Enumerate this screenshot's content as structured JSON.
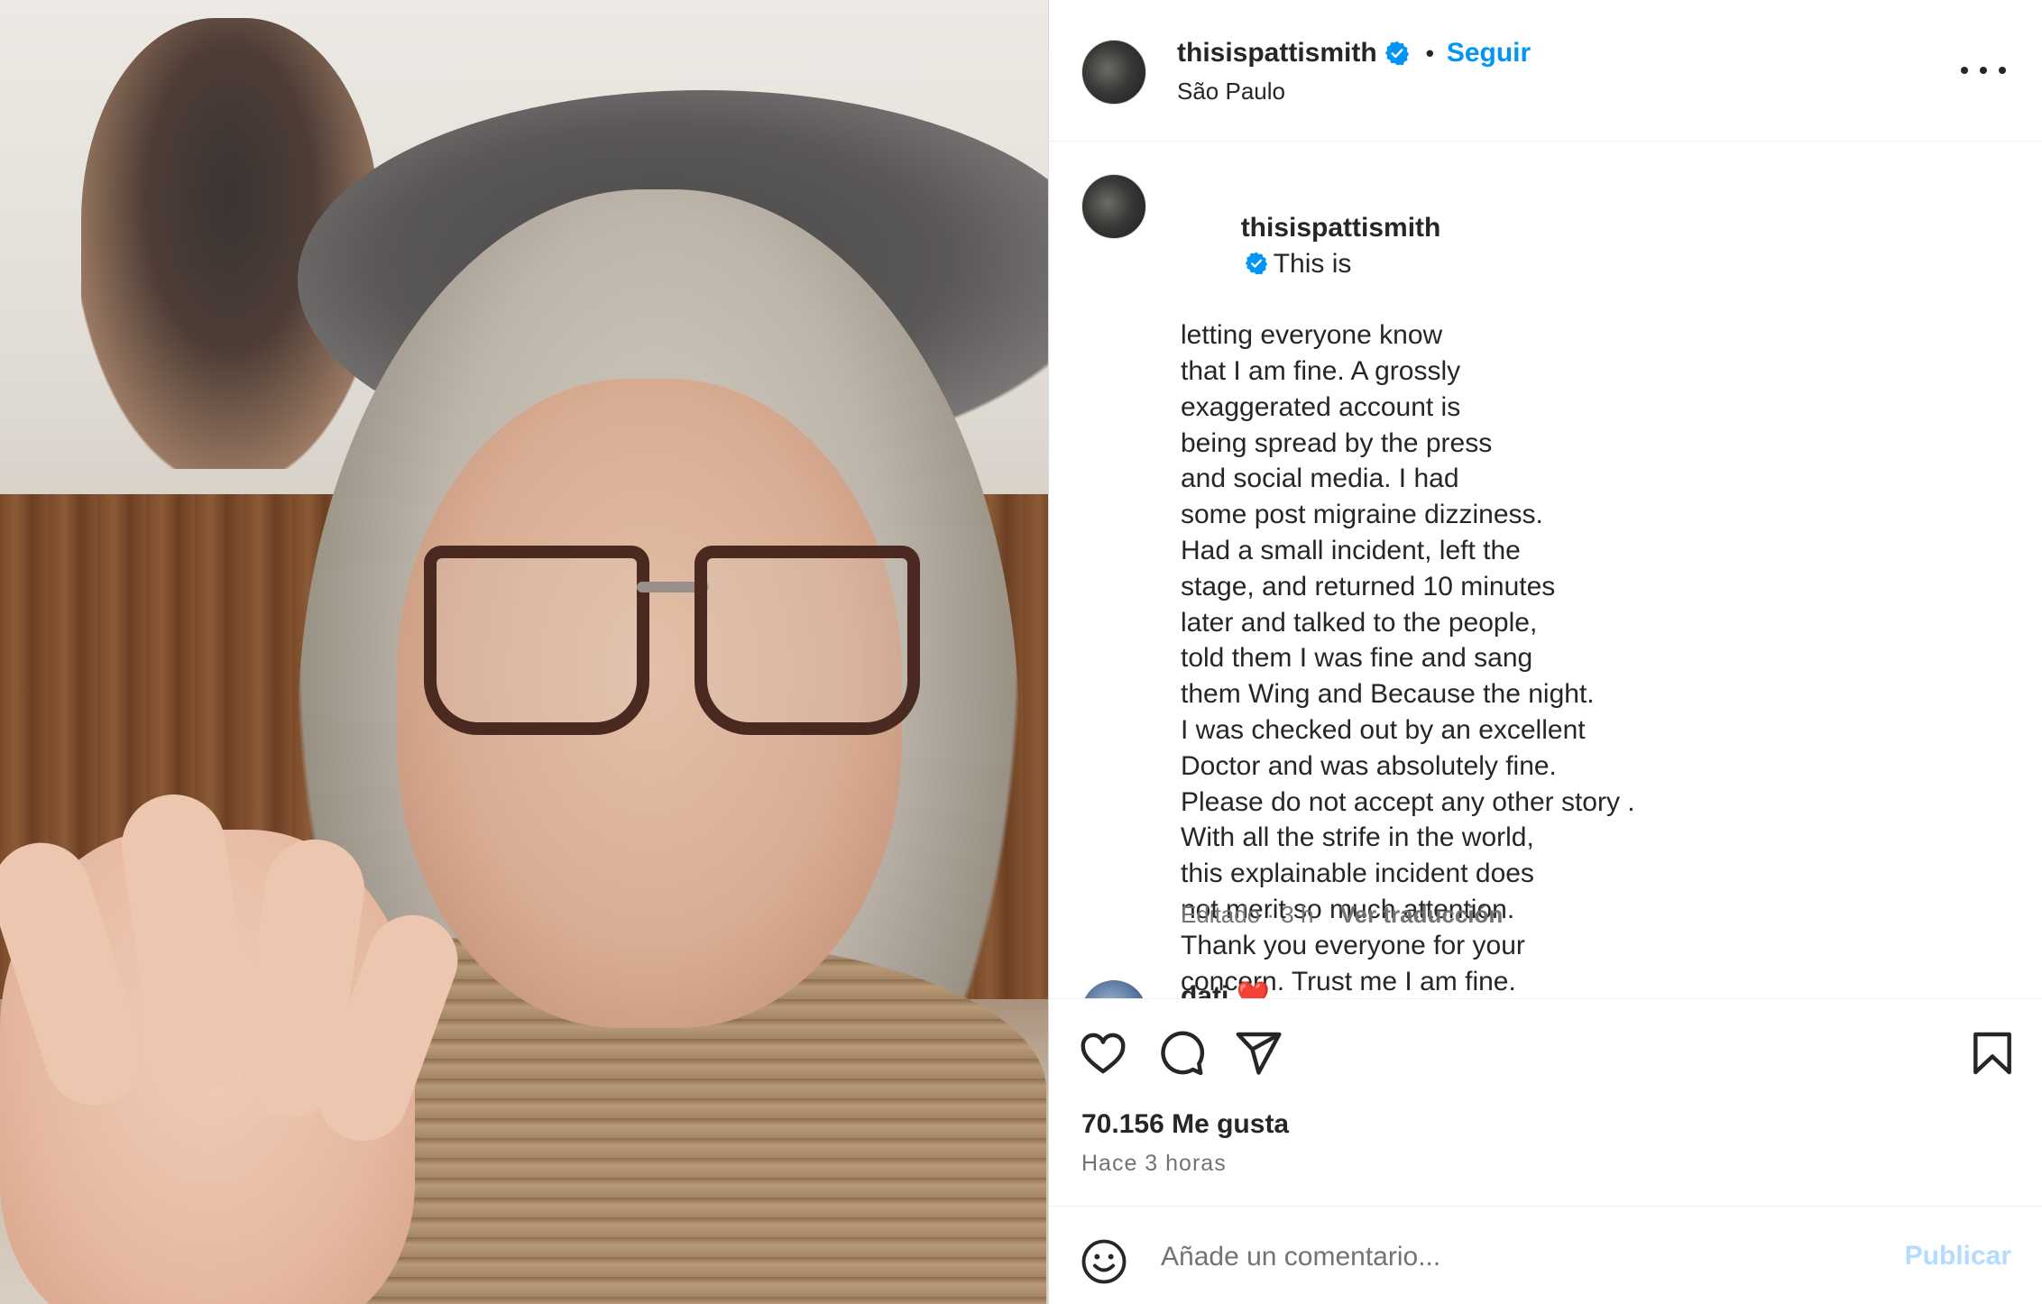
{
  "header": {
    "username": "thisispattismith",
    "separator": "•",
    "follow_label": "Seguir",
    "location": "São Paulo"
  },
  "caption": {
    "username": "thisispattismith",
    "lines": [
      "This is",
      "letting everyone know",
      "that I am fine. A grossly",
      "exaggerated account is",
      "being spread by the press",
      "and social media. I had",
      "some post migraine dizziness.",
      "Had a small incident, left the",
      "stage, and returned 10 minutes",
      "later and talked to the people,",
      "told them I was fine and sang",
      "them Wing and Because the night.",
      "I was checked out by an excellent",
      "Doctor and was absolutely fine.",
      "Please do not accept any other story .",
      "With all the strife in the world,",
      "this explainable incident does",
      "not merit so much attention.",
      "Thank you everyone for your",
      "concern. Trust me I am fine."
    ],
    "meta": "Editado · 3 h",
    "translate_label": "Ver traducción"
  },
  "next_comment": {
    "username": "dati",
    "emoji": "❤️"
  },
  "actions": {
    "likes": "70.156 Me gusta",
    "time": "Hace 3 horas"
  },
  "comment_box": {
    "placeholder": "Añade un comentario...",
    "publish_label": "Publicar"
  },
  "icons": [
    "more-options-icon",
    "heart-icon",
    "comment-icon",
    "share-icon",
    "bookmark-icon",
    "emoji-icon",
    "verified-icon"
  ],
  "colors": {
    "link_blue": "#0095f6",
    "verified_blue": "#0095f6",
    "publish_disabled": "#b3dbff",
    "secondary_text": "#737373"
  }
}
